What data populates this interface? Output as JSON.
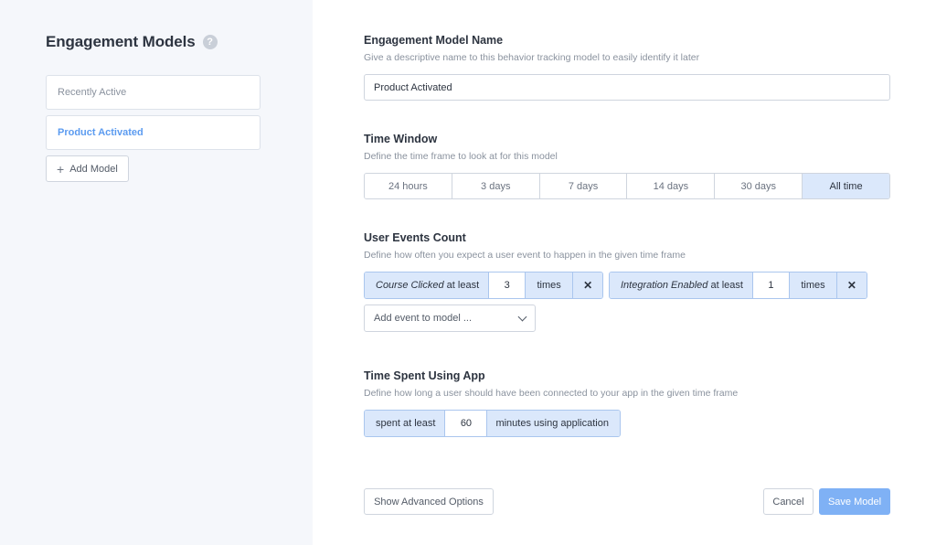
{
  "sidebar": {
    "title": "Engagement Models",
    "help_icon": "question-circle-icon",
    "models": [
      {
        "label": "Recently Active",
        "active": false
      },
      {
        "label": "Product Activated",
        "active": true
      }
    ],
    "add_model_label": "Add Model",
    "add_model_icon": "plus-icon"
  },
  "name_section": {
    "title": "Engagement Model Name",
    "description": "Give a descriptive name to this behavior tracking model to easily identify it later",
    "value": "Product Activated"
  },
  "time_window": {
    "title": "Time Window",
    "description": "Define the time frame to look at for this model",
    "options": [
      "24 hours",
      "3 days",
      "7 days",
      "14 days",
      "30 days",
      "All time"
    ],
    "selected": "All time"
  },
  "events": {
    "title": "User Events Count",
    "description": "Define how often you expect a user event to happen in the given time frame",
    "items": [
      {
        "event": "Course Clicked",
        "qualifier": "at least",
        "count": "3",
        "unit": "times",
        "remove_icon": "close-icon"
      },
      {
        "event": "Integration Enabled",
        "qualifier": "at least",
        "count": "1",
        "unit": "times",
        "remove_icon": "close-icon"
      }
    ],
    "add_placeholder": "Add event to model ...",
    "add_icon": "chevron-down-icon"
  },
  "time_spent": {
    "title": "Time Spent Using App",
    "description": "Define how long a user should have been connected to your app in the given time frame",
    "prefix": "spent at least",
    "value": "60",
    "suffix": "minutes using application"
  },
  "footer": {
    "advanced_label": "Show Advanced Options",
    "cancel_label": "Cancel",
    "save_label": "Save Model"
  },
  "colors": {
    "accent": "#7fb1f5",
    "selected_bg": "#dbe8fb",
    "active_text": "#5b9bf0",
    "sidebar_bg": "#f5f7fb"
  }
}
